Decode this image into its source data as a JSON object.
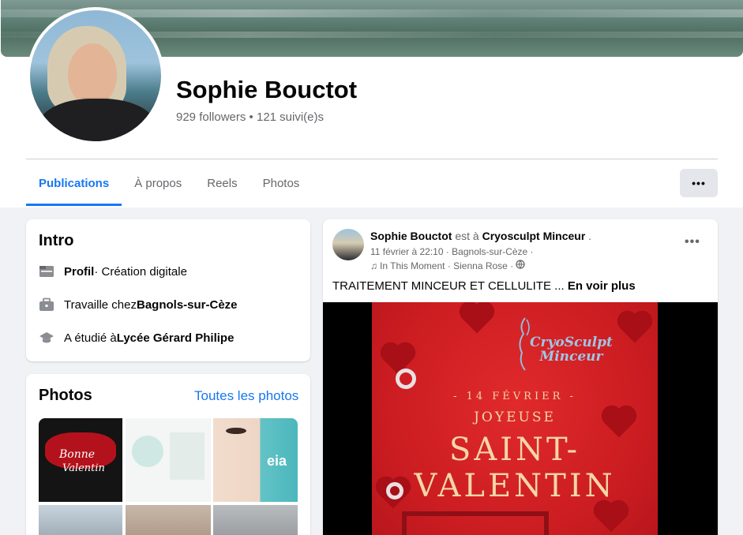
{
  "profile": {
    "name": "Sophie Bouctot",
    "followers": "929 followers",
    "separator": " • ",
    "following": "121 suivi(e)s"
  },
  "tabs": [
    {
      "label": "Publications",
      "active": true
    },
    {
      "label": "À propos",
      "active": false
    },
    {
      "label": "Reels",
      "active": false
    },
    {
      "label": "Photos",
      "active": false
    }
  ],
  "more_button": "•••",
  "intro": {
    "title": "Intro",
    "rows": [
      {
        "icon": "briefcase-folder-icon",
        "bold": "Profil",
        "text": " · Création digitale"
      },
      {
        "icon": "work-bag-icon",
        "text": "Travaille chez ",
        "bold": "Bagnols-sur-Cèze"
      },
      {
        "icon": "graduation-cap-icon",
        "text": "A étudié à ",
        "bold": "Lycée Gérard Philipe"
      }
    ]
  },
  "photos": {
    "title": "Photos",
    "see_all": "Toutes les photos"
  },
  "post": {
    "author": "Sophie Bouctot",
    "at_text": " est à ",
    "place": "Cryosculpt Minceur",
    "period": " .",
    "meta": "11 février à 22:10 · Bagnols-sur-Cèze ·",
    "music": "In This Moment · Sienna Rose ·",
    "dots": "•••",
    "text": "TRAITEMENT MINCEUR ET CELLULITE ... ",
    "see_more": "En voir plus",
    "poster": {
      "brand_line1": "CryoSculpt",
      "brand_line2": "Minceur",
      "date": "- 14 FÉVRIER -",
      "greeting": "JOYEUSE",
      "title_line1": "SAINT-",
      "title_line2": "VALENTIN"
    }
  },
  "colors": {
    "accent": "#1877f2",
    "text": "#050505",
    "muted": "#65676b",
    "background": "#f0f2f5",
    "poster_red": "#cc1d22"
  }
}
